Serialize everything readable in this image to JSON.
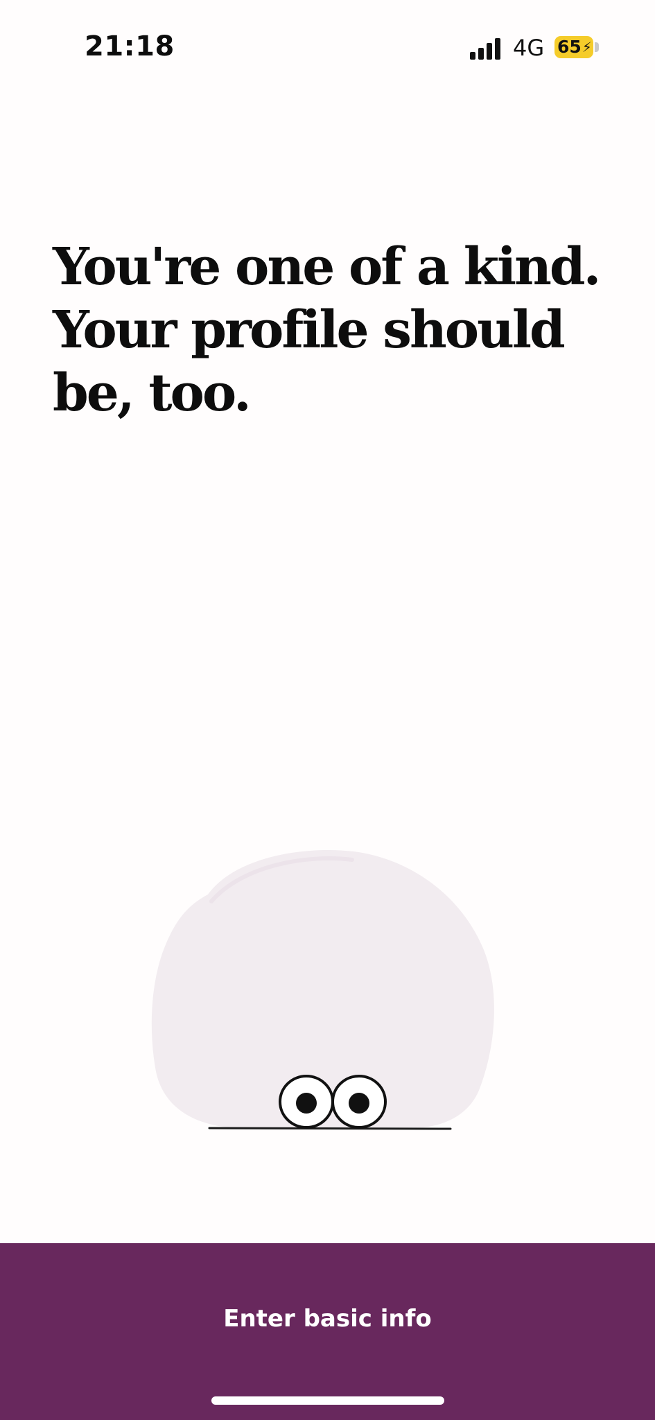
{
  "status_bar": {
    "time": "21:18",
    "network": "4G",
    "battery": "65",
    "icons": [
      "signal-bars-icon",
      "battery-icon",
      "charging-bolt-icon"
    ]
  },
  "headline": {
    "line1": "You're one of a kind.",
    "line2": "Your profile should",
    "line3": "be, too."
  },
  "illustration": {
    "icon": "peeking-eyes-blob-icon",
    "blob_color": "#f2ecf0"
  },
  "cta": {
    "label": "Enter basic info",
    "background": "#68285d"
  },
  "colors": {
    "page_background": "#fffdfd",
    "text": "#0d0d0d",
    "battery_accent": "#f5cc2a"
  }
}
